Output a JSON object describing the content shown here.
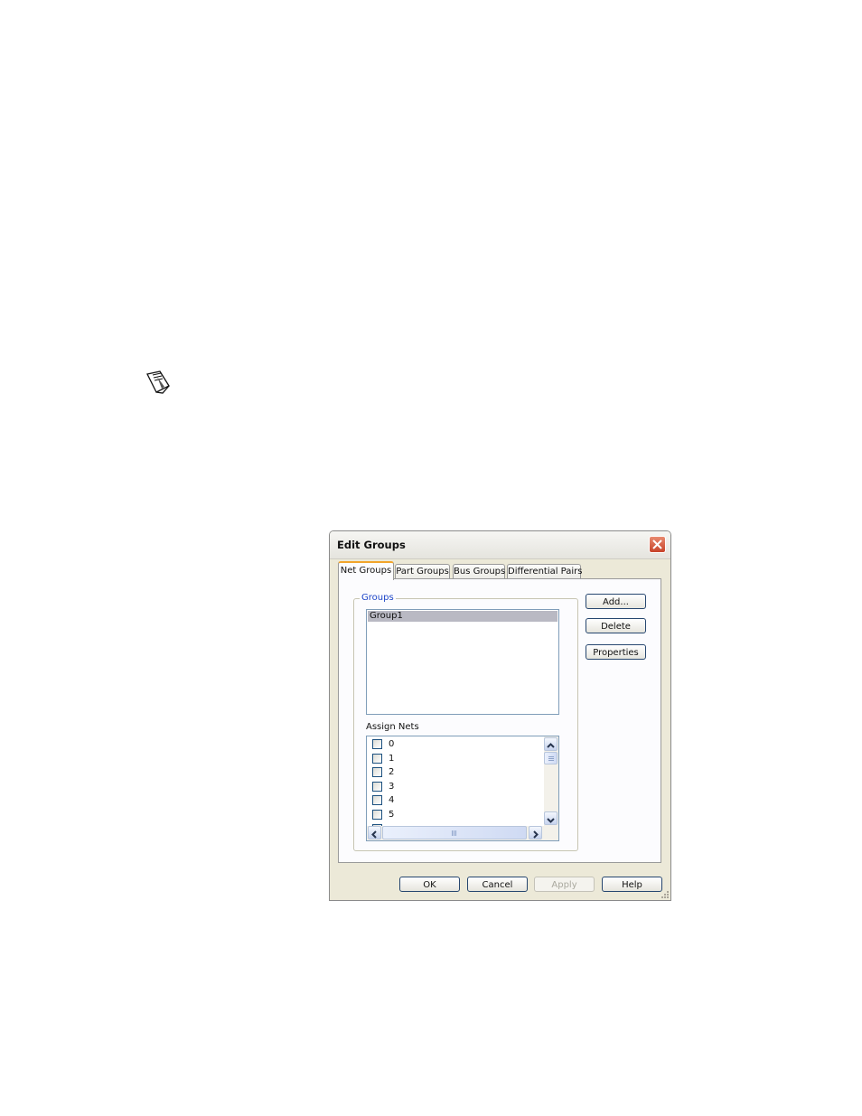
{
  "dialog": {
    "title": "Edit Groups",
    "tabs": [
      "Net Groups",
      "Part Groups",
      "Bus Groups",
      "Differential Pairs"
    ],
    "active_tab": "Net Groups",
    "groups_label": "Groups",
    "groups": [
      "Group1"
    ],
    "selected_group": "Group1",
    "assign_nets_label": "Assign Nets",
    "nets": [
      "0",
      "1",
      "2",
      "3",
      "4",
      "5"
    ],
    "side_buttons": {
      "add": "Add...",
      "delete": "Delete",
      "properties": "Properties"
    },
    "footer_buttons": {
      "ok": "OK",
      "cancel": "Cancel",
      "apply": "Apply",
      "help": "Help"
    }
  },
  "colors": {
    "accent_tab": "#f2a52b",
    "groups_label": "#1e46c8",
    "selection": "#b9b9c3",
    "close_button": "#c7432a"
  },
  "icons": [
    "note-icon",
    "close-icon",
    "checkbox-icon",
    "scroll-up-arrow-icon",
    "scroll-down-arrow-icon",
    "scroll-left-arrow-icon",
    "scroll-right-arrow-icon",
    "resize-grip-icon"
  ]
}
